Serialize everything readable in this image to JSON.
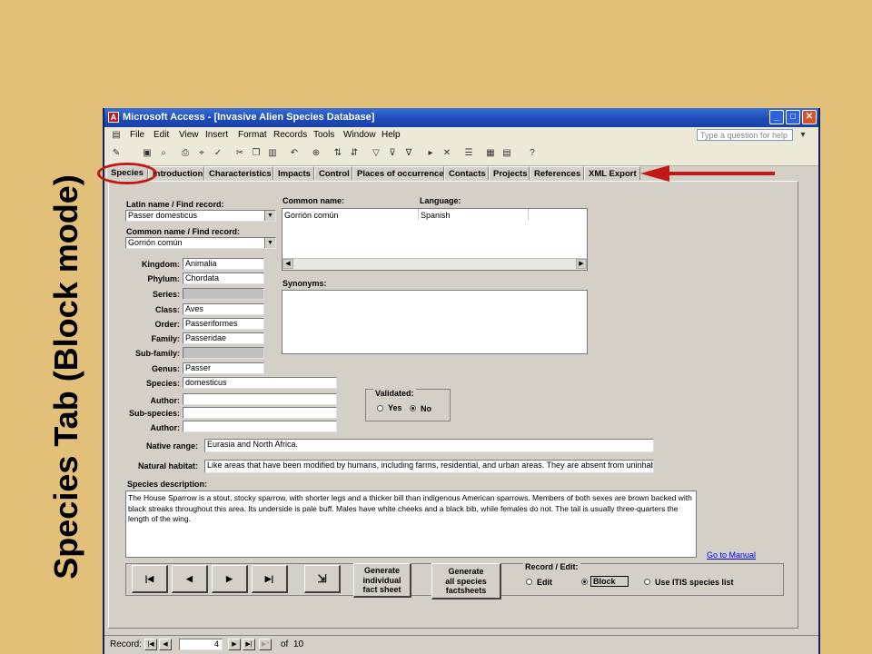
{
  "slide": {
    "title": "Species Tab (Block mode)"
  },
  "window": {
    "title": "Microsoft Access - [Invasive Alien Species Database]",
    "minimize": "_",
    "maximize": "□",
    "close": "✕"
  },
  "menu": [
    "File",
    "Edit",
    "View",
    "Insert",
    "Format",
    "Records",
    "Tools",
    "Window",
    "Help"
  ],
  "help_placeholder": "Type a question for help",
  "tabs": [
    "Species",
    "Introduction",
    "Characteristics",
    "Impacts",
    "Control",
    "Places of occurrence",
    "Contacts",
    "Projects",
    "References",
    "XML Export"
  ],
  "form": {
    "latin_label": "Latin name / Find record:",
    "latin_value": "Passer domesticus",
    "common_find_label": "Common name / Find record:",
    "common_find_value": "Gorrión común",
    "common_name_header": "Common name:",
    "language_header": "Language:",
    "common_rows": [
      {
        "name": "Gorrión común",
        "language": "Spanish"
      }
    ],
    "synonyms_label": "Synonyms:",
    "taxonomy": {
      "kingdom_label": "Kingdom:",
      "kingdom": "Animalia",
      "phylum_label": "Phylum:",
      "phylum": "Chordata",
      "series_label": "Series:",
      "class_label": "Class:",
      "class": "Aves",
      "order_label": "Order:",
      "order": "Passeriformes",
      "family_label": "Family:",
      "family": "Passeridae",
      "subfamily_label": "Sub-family:",
      "genus_label": "Genus:",
      "genus": "Passer",
      "species_label": "Species:",
      "species": "domesticus",
      "author_label": "Author:",
      "subspecies_label": "Sub-species:",
      "author2_label": "Author:"
    },
    "validated": {
      "label": "Validated:",
      "yes": "Yes",
      "no": "No",
      "selected": "No"
    },
    "native_range_label": "Native range:",
    "native_range": "Eurasia and North Africa.",
    "natural_habitat_label": "Natural habitat:",
    "natural_habitat": "Like areas that have been modified by humans, including farms, residential, and urban areas. They are absent from uninhabited w",
    "description_label": "Species description:",
    "description": "The House Sparrow is a stout, stocky sparrow, with shorter legs and a thicker bill than indigenous American sparrows. Members of both sexes are brown backed with black streaks throughout this area. Its underside is pale buff. Males have white cheeks and a black bib, while females do not. The tail is usually three-quarters the length of the wing.",
    "manual_link": "Go to Manual"
  },
  "buttons": {
    "first": "|◀",
    "prev": "◀",
    "next": "▶",
    "last": "▶|",
    "gen_individual": [
      "Generate",
      "individual",
      "fact sheet"
    ],
    "gen_all": [
      "Generate",
      "all species",
      "factsheets"
    ]
  },
  "record_edit": {
    "label": "Record / Edit:",
    "edit": "Edit",
    "block": "Block",
    "itis": "Use ITIS species list",
    "selected": "Block"
  },
  "status": {
    "record_label": "Record:",
    "current": "4",
    "of_label": "of",
    "total": "10"
  },
  "colors": {
    "background": "#e2c07a",
    "annotation": "#c41616",
    "titlebar": "#1c49b8"
  }
}
